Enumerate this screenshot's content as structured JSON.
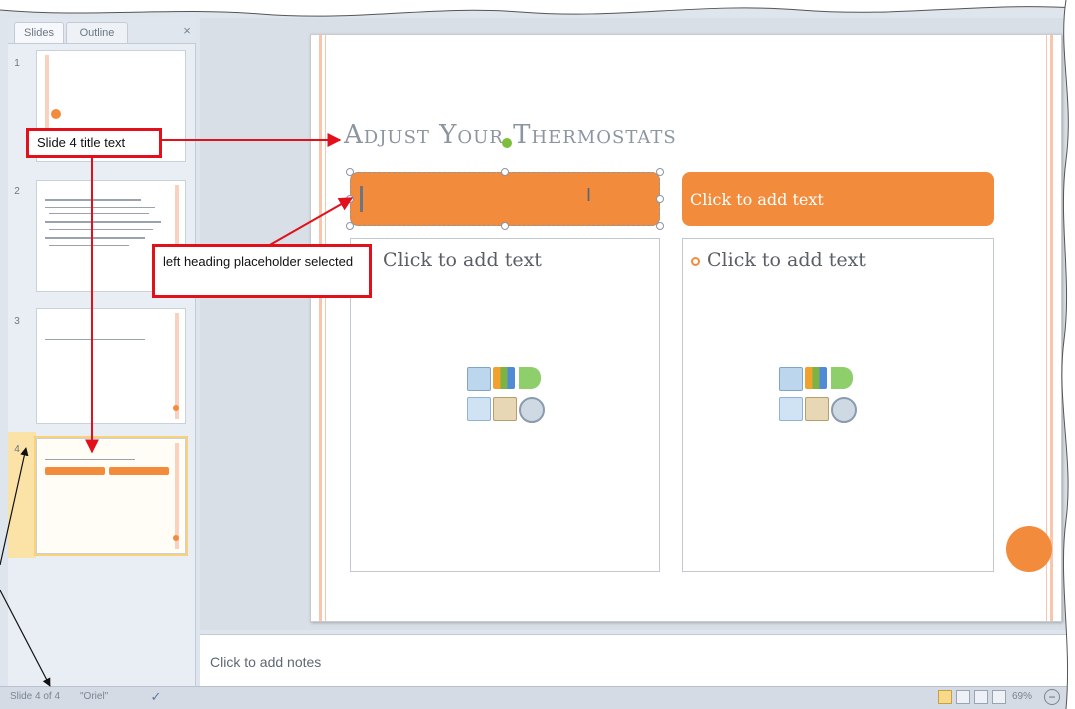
{
  "pane": {
    "tabs": [
      "Slides",
      "Outline"
    ],
    "close_glyph": "×",
    "thumbnails": [
      {
        "number": "1"
      },
      {
        "number": "2"
      },
      {
        "number": "3"
      },
      {
        "number": "4",
        "selected": true
      }
    ]
  },
  "slide": {
    "title": "Adjust Your Thermostats",
    "right_heading_placeholder": "Click to add text",
    "left_content_placeholder": "Click to add text",
    "right_content_placeholder": "Click to add text"
  },
  "notes": {
    "placeholder": "Click to add notes"
  },
  "status_bar": {
    "slide_position": "Slide 4 of 4",
    "theme": "\"Oriel\"",
    "zoom": "69%",
    "zoom_out": "−"
  },
  "callouts": {
    "title_text": "Slide 4 title text",
    "left_heading": "left heading placeholder selected"
  },
  "icons": {
    "spell_check": "spell-check-icon",
    "view_normal": "normal-view-icon",
    "view_sorter": "slide-sorter-icon",
    "view_reading": "reading-view-icon",
    "view_slideshow": "slide-show-icon",
    "content_insert": [
      "table-icon",
      "chart-icon",
      "smartart-icon",
      "picture-icon",
      "clip-art-icon",
      "media-icon"
    ]
  },
  "colors": {
    "accent": "#f28c3c",
    "callout_border": "#e1101b",
    "selection": "#fbe3a8"
  }
}
